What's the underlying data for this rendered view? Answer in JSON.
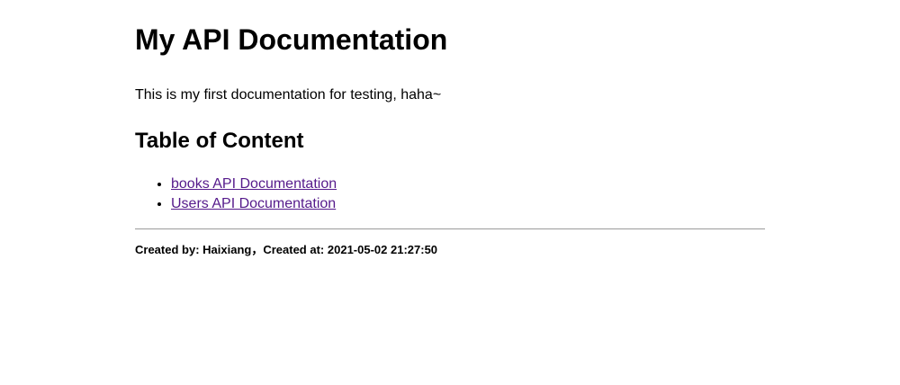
{
  "header": {
    "title": "My API Documentation"
  },
  "intro": {
    "text": "This is my first documentation for testing, haha~"
  },
  "toc": {
    "title": "Table of Content",
    "items": [
      {
        "label": "books API Documentation"
      },
      {
        "label": "Users API Documentation"
      }
    ],
    "link_color": "#551a8b"
  },
  "footer": {
    "created_by_label": "Created by: ",
    "author": "Haixiang",
    "separator": "，",
    "created_at_label": "Created at: ",
    "created_at": "2021-05-02 21:27:50"
  }
}
